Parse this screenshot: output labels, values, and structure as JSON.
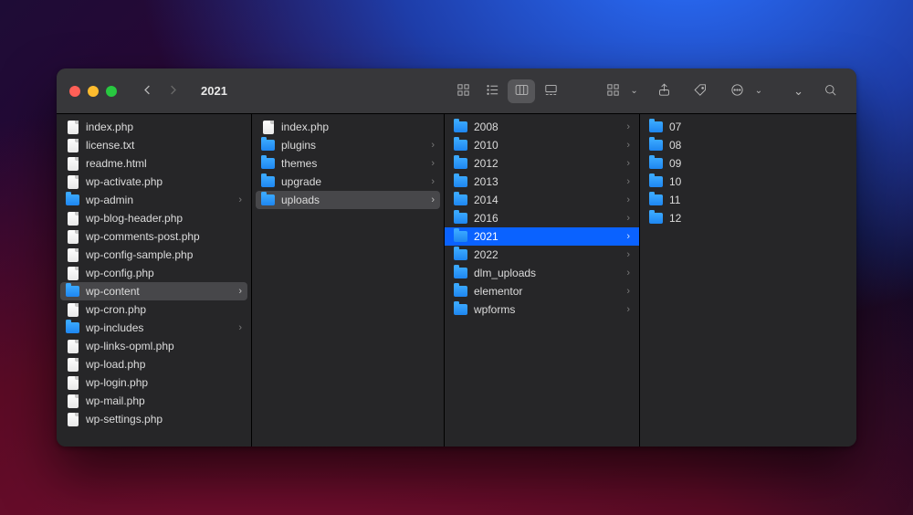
{
  "window_title": "2021",
  "columns": [
    {
      "width": "c1",
      "items": [
        {
          "name": "index.php",
          "type": "file"
        },
        {
          "name": "license.txt",
          "type": "file"
        },
        {
          "name": "readme.html",
          "type": "file"
        },
        {
          "name": "wp-activate.php",
          "type": "file"
        },
        {
          "name": "wp-admin",
          "type": "folder",
          "expandable": true
        },
        {
          "name": "wp-blog-header.php",
          "type": "file"
        },
        {
          "name": "wp-comments-post.php",
          "type": "file"
        },
        {
          "name": "wp-config-sample.php",
          "type": "file"
        },
        {
          "name": "wp-config.php",
          "type": "file"
        },
        {
          "name": "wp-content",
          "type": "folder",
          "expandable": true,
          "state": "sel"
        },
        {
          "name": "wp-cron.php",
          "type": "file"
        },
        {
          "name": "wp-includes",
          "type": "folder",
          "expandable": true
        },
        {
          "name": "wp-links-opml.php",
          "type": "file"
        },
        {
          "name": "wp-load.php",
          "type": "file"
        },
        {
          "name": "wp-login.php",
          "type": "file"
        },
        {
          "name": "wp-mail.php",
          "type": "file"
        },
        {
          "name": "wp-settings.php",
          "type": "file"
        }
      ]
    },
    {
      "width": "c2",
      "items": [
        {
          "name": "index.php",
          "type": "file"
        },
        {
          "name": "plugins",
          "type": "folder",
          "expandable": true
        },
        {
          "name": "themes",
          "type": "folder",
          "expandable": true
        },
        {
          "name": "upgrade",
          "type": "folder",
          "expandable": true
        },
        {
          "name": "uploads",
          "type": "folder",
          "expandable": true,
          "state": "sel"
        }
      ]
    },
    {
      "width": "c3",
      "items": [
        {
          "name": "2008",
          "type": "folder",
          "expandable": true
        },
        {
          "name": "2010",
          "type": "folder",
          "expandable": true
        },
        {
          "name": "2012",
          "type": "folder",
          "expandable": true
        },
        {
          "name": "2013",
          "type": "folder",
          "expandable": true
        },
        {
          "name": "2014",
          "type": "folder",
          "expandable": true
        },
        {
          "name": "2016",
          "type": "folder",
          "expandable": true
        },
        {
          "name": "2021",
          "type": "folder",
          "expandable": true,
          "state": "active"
        },
        {
          "name": "2022",
          "type": "folder",
          "expandable": true
        },
        {
          "name": "dlm_uploads",
          "type": "folder",
          "expandable": true
        },
        {
          "name": "elementor",
          "type": "folder",
          "expandable": true
        },
        {
          "name": "wpforms",
          "type": "folder",
          "expandable": true
        }
      ]
    },
    {
      "width": "c4",
      "items": [
        {
          "name": "07",
          "type": "folder"
        },
        {
          "name": "08",
          "type": "folder"
        },
        {
          "name": "09",
          "type": "folder"
        },
        {
          "name": "10",
          "type": "folder"
        },
        {
          "name": "11",
          "type": "folder"
        },
        {
          "name": "12",
          "type": "folder"
        }
      ]
    }
  ]
}
